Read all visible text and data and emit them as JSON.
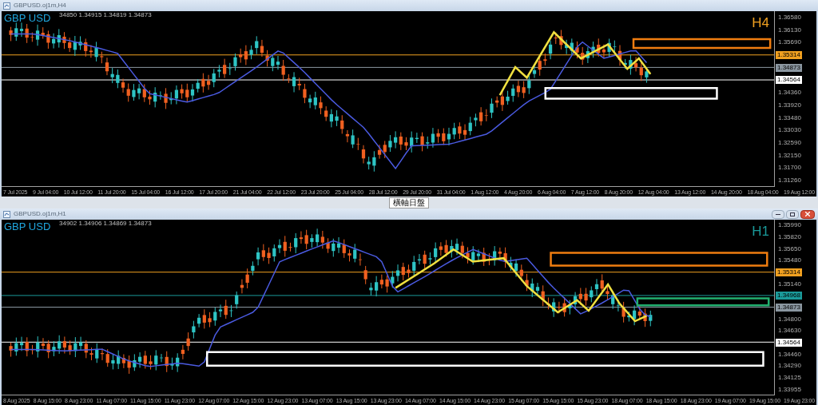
{
  "panes": [
    {
      "title": "GBPUSD.oj1m,H4",
      "ohlc": "34850 1.34915 1.34819 1.34873",
      "symbol": "GBP USD",
      "timeframe": "H4",
      "color": "#f0a020",
      "window_buttons": false,
      "price_axis": [
        {
          "kind": "tick",
          "text": "1.36580"
        },
        {
          "kind": "tick",
          "text": "1.36130"
        },
        {
          "kind": "tick",
          "text": "1.35690"
        },
        {
          "kind": "tag",
          "text": "1.35314",
          "color": "#f0a020"
        },
        {
          "kind": "tag",
          "text": "1.34873",
          "color": "#8a96a0"
        },
        {
          "kind": "tag",
          "text": "1.34564",
          "color": "#ffffff"
        },
        {
          "kind": "tick",
          "text": "1.34360"
        },
        {
          "kind": "tick",
          "text": "1.33920"
        },
        {
          "kind": "tick",
          "text": "1.33480"
        },
        {
          "kind": "tick",
          "text": "1.33030"
        },
        {
          "kind": "tick",
          "text": "1.32590"
        },
        {
          "kind": "tick",
          "text": "1.32150"
        },
        {
          "kind": "tick",
          "text": "1.31700"
        },
        {
          "kind": "tick",
          "text": "1.31260"
        }
      ],
      "time_labels": [
        "7 Jul 2025",
        "9 Jul 04:00",
        "10 Jul 12:00",
        "11 Jul 20:00",
        "15 Jul 04:00",
        "16 Jul 12:00",
        "17 Jul 20:00",
        "21 Jul 04:00",
        "22 Jul 12:00",
        "23 Jul 20:00",
        "25 Jul 04:00",
        "28 Jul 12:00",
        "29 Jul 20:00",
        "31 Jul 04:00",
        "1 Aug 12:00",
        "4 Aug 20:00",
        "6 Aug 04:00",
        "7 Aug 12:00",
        "8 Aug 20:00",
        "12 Aug 04:00",
        "13 Aug 12:00",
        "14 Aug 20:00",
        "18 Aug 04:00",
        "19 Aug 12:00"
      ]
    },
    {
      "title": "GBPUSD.oj1m,H1",
      "ohlc": "34902 1.34906 1.34869 1.34873",
      "symbol": "GBP USD",
      "timeframe": "H1",
      "color": "#1a9a9a",
      "window_buttons": true,
      "price_axis": [
        {
          "kind": "tick",
          "text": "1.35990"
        },
        {
          "kind": "tick",
          "text": "1.35820"
        },
        {
          "kind": "tick",
          "text": "1.35650"
        },
        {
          "kind": "tick",
          "text": "1.35480"
        },
        {
          "kind": "tag",
          "text": "1.35314",
          "color": "#f0a020"
        },
        {
          "kind": "tick",
          "text": "1.35140"
        },
        {
          "kind": "tag",
          "text": "1.34968",
          "color": "#1a9a9a"
        },
        {
          "kind": "tag",
          "text": "1.34873",
          "color": "#8a96a0"
        },
        {
          "kind": "tick",
          "text": "1.34800"
        },
        {
          "kind": "tick",
          "text": "1.34630"
        },
        {
          "kind": "tag",
          "text": "1.34564",
          "color": "#ffffff"
        },
        {
          "kind": "tick",
          "text": "1.34460"
        },
        {
          "kind": "tick",
          "text": "1.34290"
        },
        {
          "kind": "tick",
          "text": "1.34125"
        },
        {
          "kind": "tick",
          "text": "1.33955"
        }
      ],
      "time_labels": [
        "8 Aug 2025",
        "8 Aug 15:00",
        "8 Aug 23:00",
        "11 Aug 07:00",
        "11 Aug 15:00",
        "11 Aug 23:00",
        "12 Aug 07:00",
        "12 Aug 15:00",
        "12 Aug 23:00",
        "13 Aug 07:00",
        "13 Aug 15:00",
        "13 Aug 23:00",
        "14 Aug 07:00",
        "14 Aug 15:00",
        "14 Aug 23:00",
        "15 Aug 07:00",
        "15 Aug 15:00",
        "15 Aug 23:00",
        "18 Aug 07:00",
        "18 Aug 15:00",
        "18 Aug 23:00",
        "19 Aug 07:00",
        "19 Aug 15:00",
        "19 Aug 23:00"
      ]
    }
  ],
  "tooltip": "橫軸日盤"
}
